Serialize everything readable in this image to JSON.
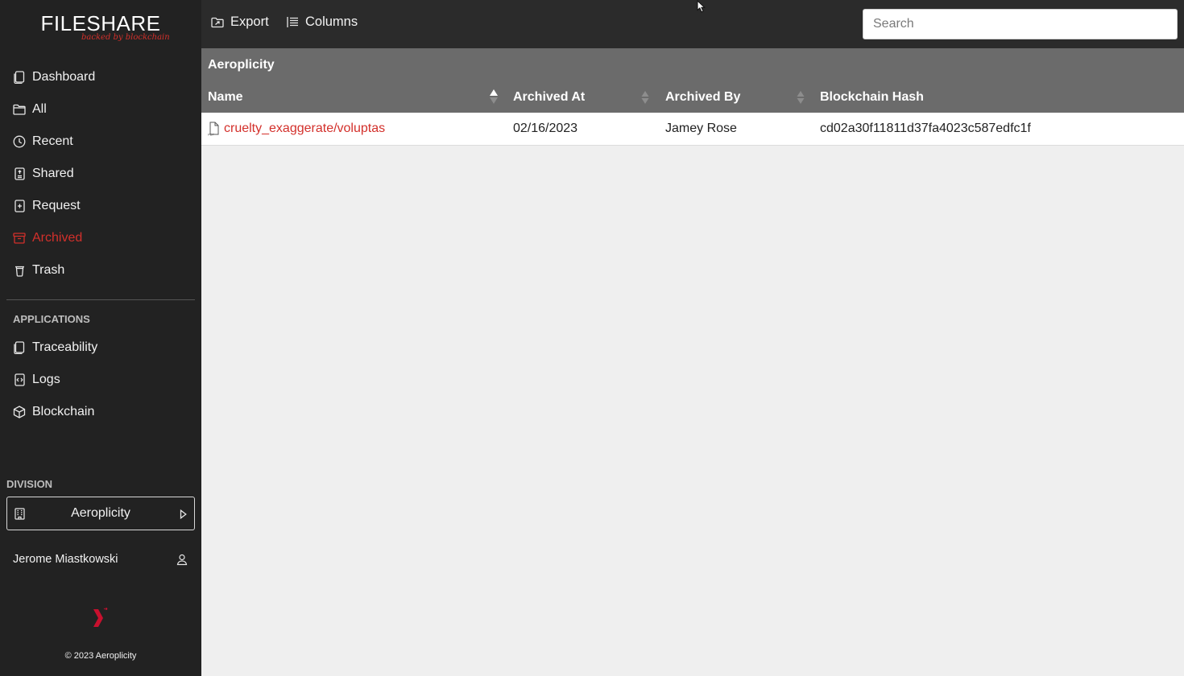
{
  "brand": {
    "title": "FILESHARE",
    "tagline": "backed by blockchain",
    "accent": "#d3302b"
  },
  "nav": {
    "items": [
      {
        "label": "Dashboard",
        "icon": "document-icon"
      },
      {
        "label": "All",
        "icon": "folder-icon"
      },
      {
        "label": "Recent",
        "icon": "clock-icon"
      },
      {
        "label": "Shared",
        "icon": "shared-file-icon"
      },
      {
        "label": "Request",
        "icon": "request-file-icon"
      },
      {
        "label": "Archived",
        "icon": "archive-box-icon",
        "active": true
      },
      {
        "label": "Trash",
        "icon": "trash-icon"
      }
    ]
  },
  "applications": {
    "heading": "APPLICATIONS",
    "items": [
      {
        "label": "Traceability",
        "icon": "document-icon"
      },
      {
        "label": "Logs",
        "icon": "code-file-icon"
      },
      {
        "label": "Blockchain",
        "icon": "cube-icon"
      }
    ]
  },
  "division": {
    "heading": "DIVISION",
    "selected": "Aeroplicity"
  },
  "user": {
    "name": "Jerome Miastkowski"
  },
  "footer": {
    "copyright": "© 2023 Aeroplicity"
  },
  "toolbar": {
    "export_label": "Export",
    "columns_label": "Columns"
  },
  "search": {
    "placeholder": "Search",
    "value": ""
  },
  "table": {
    "group_title": "Aeroplicity",
    "columns": [
      "Name",
      "Archived At",
      "Archived By",
      "Blockchain Hash"
    ],
    "rows": [
      {
        "name": "cruelty_exaggerate/voluptas",
        "archived_at": "02/16/2023",
        "archived_by": "Jamey Rose",
        "hash": "cd02a30f11811d37fa4023c587edfc1f"
      }
    ]
  }
}
